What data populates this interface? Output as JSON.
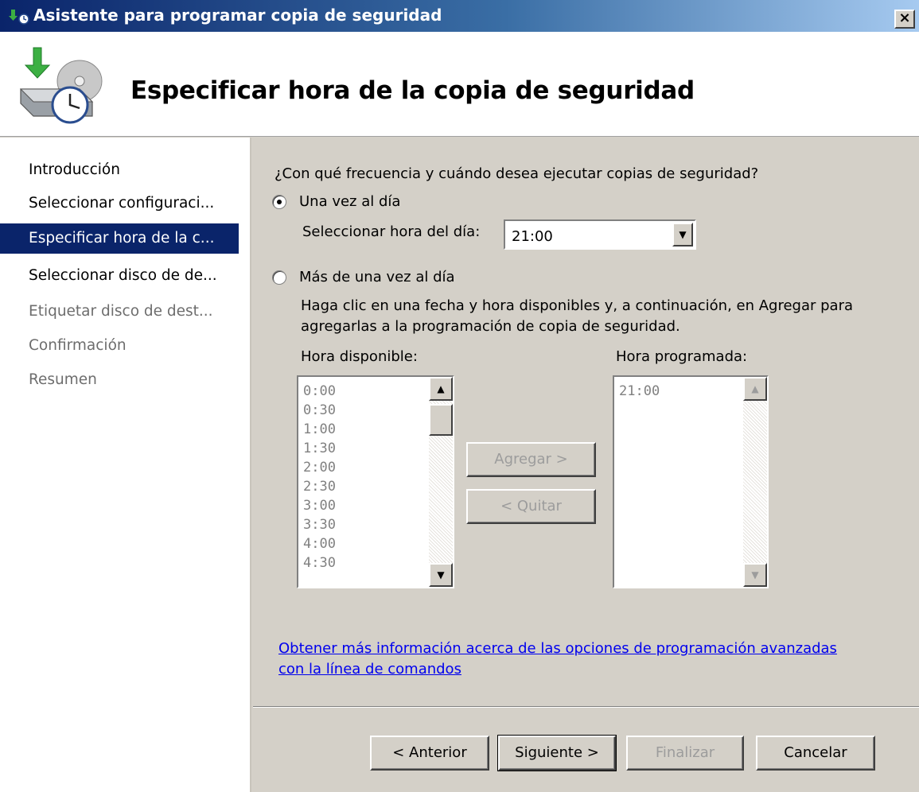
{
  "window": {
    "title": "Asistente para programar copia de seguridad",
    "close_label": "×"
  },
  "header": {
    "heading": "Especificar hora de la copia de seguridad"
  },
  "sidebar": {
    "items": [
      {
        "label": "Introducción",
        "state": "done"
      },
      {
        "label": "Seleccionar configuraci...",
        "state": "done"
      },
      {
        "label": "Especificar hora de la c...",
        "state": "active"
      },
      {
        "label": "Seleccionar disco de de...",
        "state": "done"
      },
      {
        "label": "Etiquetar disco de dest...",
        "state": "disabled"
      },
      {
        "label": "Confirmación",
        "state": "disabled"
      },
      {
        "label": "Resumen",
        "state": "disabled"
      }
    ]
  },
  "main": {
    "question": "¿Con qué frecuencia y cuándo desea ejecutar copias de seguridad?",
    "once_label": "Una vez al día",
    "once_selected": true,
    "time_label": "Seleccionar hora del día:",
    "time_value": "21:00",
    "multi_label": "Más de una vez al día",
    "multi_selected": false,
    "instructions_line1": "Haga clic en una fecha y hora disponibles y, a continuación, en Agregar para",
    "instructions_line2": "agregarlas a la programación de copia de seguridad.",
    "available_label": "Hora disponible:",
    "available_times": [
      "0:00",
      "0:30",
      "1:00",
      "1:30",
      "2:00",
      "2:30",
      "3:00",
      "3:30",
      "4:00",
      "4:30"
    ],
    "scheduled_label": "Hora programada:",
    "scheduled_times": [
      "21:00"
    ],
    "add_button": "Agregar >",
    "remove_button": "< Quitar",
    "link_line1": "Obtener más información acerca de las opciones de programación avanzadas",
    "link_line2": "con la línea de comandos"
  },
  "footer": {
    "back": "< Anterior",
    "next": "Siguiente >",
    "finish": "Finalizar",
    "cancel": "Cancelar"
  },
  "icons": {
    "app": "backup-schedule-icon",
    "hero": "backup-drive-clock-icon",
    "up": "▲",
    "down": "▼"
  },
  "colors": {
    "selection": "#0a246a",
    "link": "#0000ee",
    "dialog_face": "#d4d0c8"
  }
}
